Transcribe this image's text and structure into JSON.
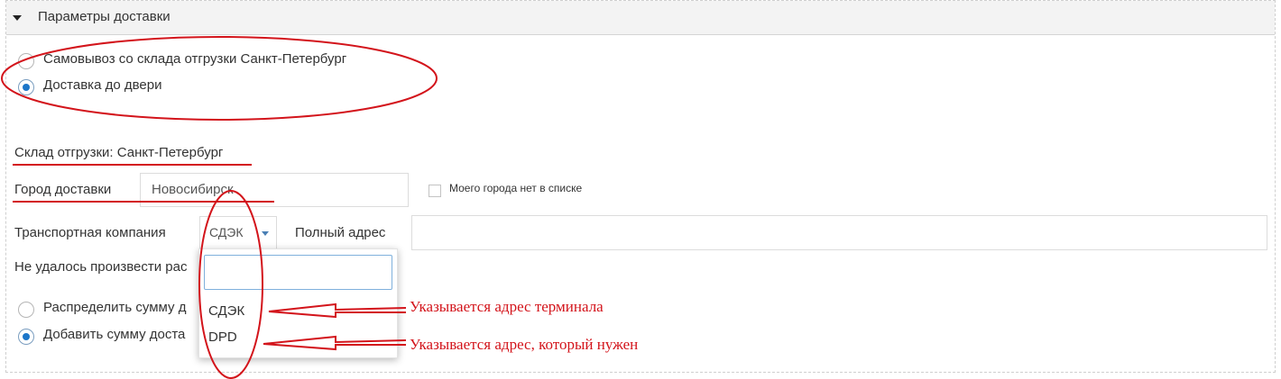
{
  "panel": {
    "title": "Параметры доставки"
  },
  "delivery_options": [
    {
      "label": "Самовывоз со склада отгрузки Санкт-Петербург",
      "checked": false
    },
    {
      "label": "Доставка до двери",
      "checked": true
    }
  ],
  "warehouse": {
    "label": "Склад отгрузки: Санкт-Петербург"
  },
  "city": {
    "label": "Город доставки",
    "value": "Новосибирск",
    "not_in_list_label": "Моего города нет в списке"
  },
  "transport": {
    "label": "Транспортная компания",
    "selected": "СДЭК",
    "options": [
      "СДЭК",
      "DPD"
    ],
    "full_address_label": "Полный адрес"
  },
  "calc_error": {
    "text": "Не удалось произвести рас"
  },
  "sum_options": [
    {
      "label": "Распределить сумму д",
      "checked": false
    },
    {
      "label": "Добавить сумму доста",
      "checked": true
    }
  ],
  "annotations": {
    "sdek_note": "Указывается адрес терминала",
    "dpd_note": "Указывается адрес, который нужен",
    "color": "#d3141b"
  },
  "colors": {
    "accent": "#1c76c9",
    "header_bg": "#f3f3f3"
  }
}
